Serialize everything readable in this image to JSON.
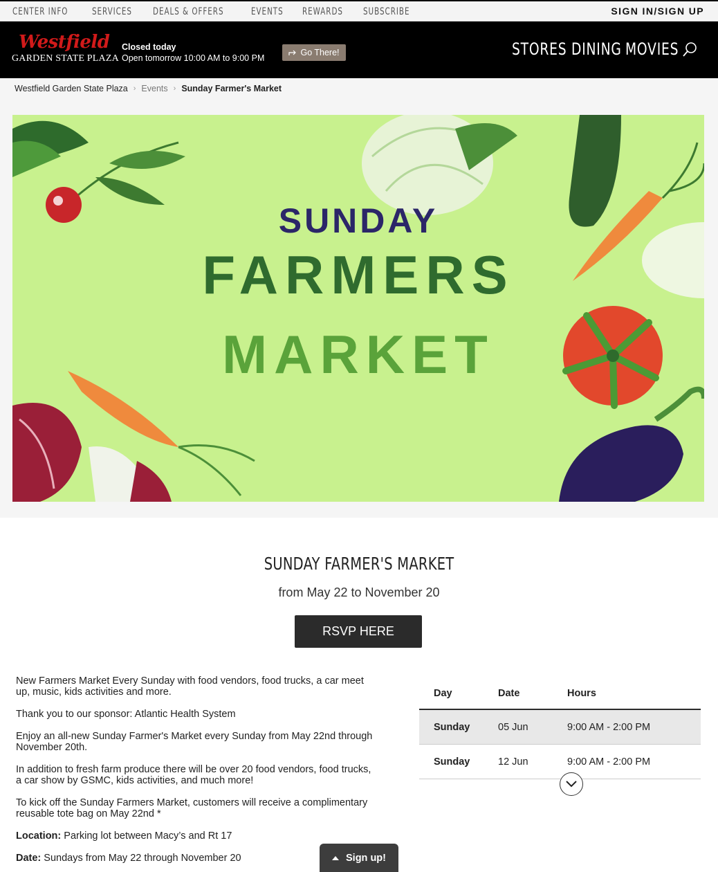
{
  "topbar": {
    "links": [
      "CENTER INFO",
      "SERVICES",
      "DEALS & OFFERS",
      "EVENTS",
      "REWARDS",
      "SUBSCRIBE"
    ],
    "signin": "SIGN IN/SIGN UP"
  },
  "header": {
    "logo_script": "Westfield",
    "logo_sub": "GARDEN STATE PLAZA",
    "closed": "Closed today",
    "open": "Open tomorrow 10:00 AM to 9:00 PM",
    "go_label": "Go There!",
    "nav": [
      "STORES",
      "DINING",
      "MOVIES"
    ],
    "colors": {
      "brand": "#d11a1a",
      "bg": "#000000"
    }
  },
  "breadcrumb": [
    "Westfield Garden State Plaza",
    "Events",
    "Sunday Farmer's Market"
  ],
  "hero": {
    "line1": "SUNDAY",
    "line2": "FARMERS",
    "line3": "MARKET",
    "bg": "#c8f18e"
  },
  "event": {
    "title": "SUNDAY FARMER'S MARKET",
    "dates": "from May 22 to November 20",
    "rsvp": "RSVP HERE",
    "paragraphs": [
      "New Farmers Market Every Sunday with food vendors, food trucks, a car meet up, music, kids activities and more.",
      "Thank you to our sponsor:  Atlantic Health System",
      "Enjoy an all-new Sunday Farmer's Market every Sunday from May 22nd through November 20th.",
      "In addition to fresh farm produce there will be over 20 food vendors, food trucks, a car show by GSMC, kids activities, and much more!",
      "To kick off the Sunday Farmers Market, customers will receive a complimentary reusable tote bag on May 22nd *"
    ],
    "location_label": "Location:",
    "location_value": " Parking lot between Macy’s and Rt 17",
    "date_label": "Date:",
    "date_value": " Sundays from May 22 through November 20"
  },
  "schedule": {
    "headers": [
      "Day",
      "Date",
      "Hours"
    ],
    "rows": [
      {
        "day": "Sunday",
        "date": "05 Jun",
        "hours": "9:00 AM - 2:00 PM"
      },
      {
        "day": "Sunday",
        "date": "12 Jun",
        "hours": "9:00 AM - 2:00 PM"
      }
    ]
  },
  "signup": {
    "label": "Sign up!"
  }
}
